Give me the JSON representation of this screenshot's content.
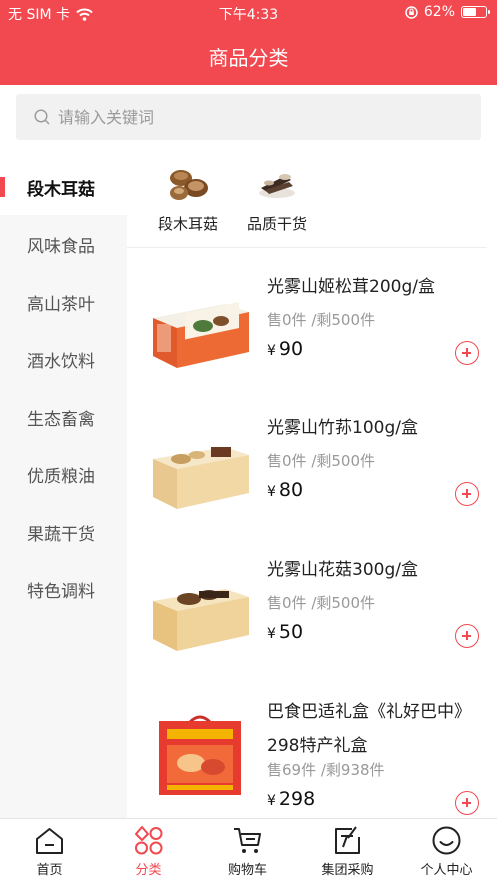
{
  "colors": {
    "accent": "#f2484f"
  },
  "status_bar": {
    "carrier": "无 SIM 卡",
    "time": "下午4:33",
    "battery": "62%",
    "battery_level": 0.62
  },
  "header": {
    "title": "商品分类"
  },
  "search": {
    "placeholder": "请输入关键词"
  },
  "sidebar": {
    "items": [
      {
        "label": "段木耳菇",
        "active": true
      },
      {
        "label": "风味食品",
        "active": false
      },
      {
        "label": "高山茶叶",
        "active": false
      },
      {
        "label": "酒水饮料",
        "active": false
      },
      {
        "label": "生态畜禽",
        "active": false
      },
      {
        "label": "优质粮油",
        "active": false
      },
      {
        "label": "果蔬干货",
        "active": false
      },
      {
        "label": "特色调料",
        "active": false
      }
    ]
  },
  "subcategories": [
    {
      "label": "段木耳菇",
      "icon": "mushroom-icon"
    },
    {
      "label": "品质干货",
      "icon": "dried-goods-icon"
    }
  ],
  "products": [
    {
      "name": "光雾山姬松茸200g/盒",
      "sold": "售0件",
      "remaining": "/剩500件",
      "currency": "¥",
      "price": "90"
    },
    {
      "name": "光雾山竹荪100g/盒",
      "sold": "售0件",
      "remaining": "/剩500件",
      "currency": "¥",
      "price": "80"
    },
    {
      "name": "光雾山花菇300g/盒",
      "sold": "售0件",
      "remaining": "/剩500件",
      "currency": "¥",
      "price": "50"
    },
    {
      "name": "巴食巴适礼盒《礼好巴中》298特产礼盒",
      "sold": "售69件",
      "remaining": "/剩938件",
      "currency": "¥",
      "price": "298"
    }
  ],
  "tabbar": {
    "items": [
      {
        "label": "首页",
        "icon": "home-icon",
        "active": false
      },
      {
        "label": "分类",
        "icon": "category-icon",
        "active": true
      },
      {
        "label": "购物车",
        "icon": "cart-icon",
        "active": false
      },
      {
        "label": "集团采购",
        "icon": "group-purchase-icon",
        "active": false
      },
      {
        "label": "个人中心",
        "icon": "profile-icon",
        "active": false
      }
    ]
  }
}
